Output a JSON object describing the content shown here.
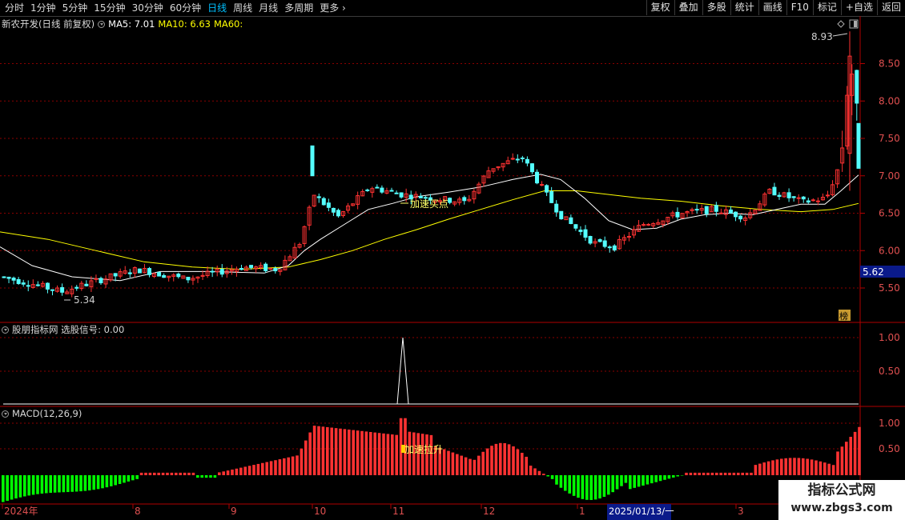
{
  "toolbar": {
    "periods": [
      "分时",
      "1分钟",
      "5分钟",
      "15分钟",
      "30分钟",
      "60分钟",
      "日线",
      "周线",
      "月线",
      "多周期",
      "更多"
    ],
    "active_period": "日线",
    "more_arrow": "›",
    "right_buttons": [
      "复权",
      "叠加",
      "多股",
      "统计",
      "画线",
      "F10",
      "标记",
      "+自选",
      "返回"
    ]
  },
  "main_panel": {
    "title": "新农开发(日线 前复权)",
    "ma5": "MA5: 7.01",
    "ma10": "MA10: 6.63",
    "ma60": "MA60:",
    "high_label": "8.93",
    "low_label": "5.34",
    "signal_label": "加速买点",
    "current_price_tag": "5.62",
    "rank_badge": "榜",
    "y_ticks": [
      "8.50",
      "8.00",
      "7.50",
      "7.00",
      "6.50",
      "6.00",
      "5.50"
    ],
    "top_icons": [
      "diamond-icon",
      "panel-toggle-icon"
    ]
  },
  "signal_panel": {
    "title": "股朋指标网 选股信号: 0.00",
    "y_ticks": [
      "1.00",
      "0.50"
    ]
  },
  "macd_panel": {
    "title": "MACD(12,26,9)",
    "signal_label": "加速拉升",
    "y_ticks": [
      "1.00",
      "0.50"
    ]
  },
  "x_axis": {
    "labels": [
      "2024年",
      "8",
      "9",
      "10",
      "11",
      "12",
      "1",
      "3"
    ],
    "cursor_date": "2025/01/13/一"
  },
  "watermark": {
    "line1": "指标公式网",
    "line2": "www.zbgs3.com"
  },
  "colors": {
    "up": "#ff3232",
    "down": "#54ffff",
    "ma5": "#ffffff",
    "ma10": "#ffff00",
    "grid": "#8b0000",
    "macd_up": "#ff3232",
    "macd_down": "#00ff00"
  }
}
